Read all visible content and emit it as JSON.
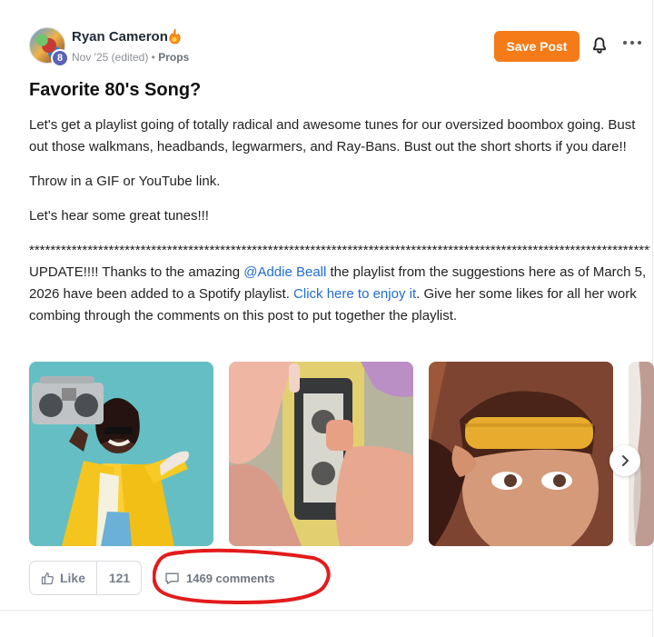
{
  "post": {
    "author": {
      "name": "Ryan Cameron",
      "level": "8",
      "meta": "Nov '25 (edited) • ",
      "props_label": "Props"
    },
    "title": "Favorite 80's Song?",
    "paragraphs": {
      "p1": "Let's get a playlist going of totally radical and awesome tunes for our oversized boombox going. Bust out those walkmans, headbands, legwarmers, and Ray-Bans. Bust out the short shorts if you dare!!",
      "p2": "Throw in a GIF or YouTube link.",
      "p3": "Let's hear some great tunes!!!",
      "separator": "************************************************************************************************************************",
      "update_before": "UPDATE!!!! Thanks to the amazing ",
      "mention": "@Addie Beall",
      "update_middle": " the playlist from the suggestions here as of March 5, 2026 have been added to a Spotify playlist. ",
      "link": "Click here to enjoy it",
      "update_after": ". Give her some likes for all her work combing through the comments on this post to put together the playlist."
    }
  },
  "actions": {
    "save_label": "Save Post",
    "like_label": "Like",
    "like_count": "121",
    "comments_label": "1469 comments"
  },
  "media": {
    "items": [
      {
        "icon": "boombox-image"
      },
      {
        "icon": "cassette-tape-image"
      },
      {
        "icon": "headband-image"
      },
      {
        "icon": "partial-next-image"
      }
    ],
    "next_icon": "chevron-right-icon"
  },
  "colors": {
    "accent": "#f47b18",
    "link": "#1f6cd7",
    "annotation": "#e31b1b",
    "badge": "#5b63b7"
  }
}
